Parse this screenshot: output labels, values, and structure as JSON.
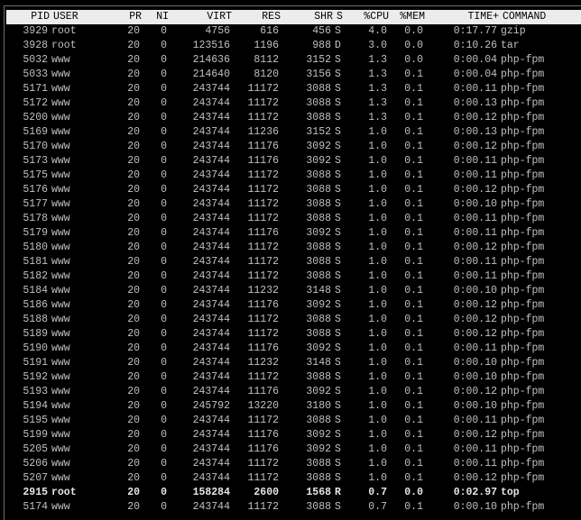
{
  "header": {
    "pid": "PID",
    "user": "USER",
    "pr": "PR",
    "ni": "NI",
    "virt": "VIRT",
    "res": "RES",
    "shr": "SHR",
    "s": "S",
    "cpu": "%CPU",
    "mem": "%MEM",
    "time": "TIME+",
    "command": "COMMAND"
  },
  "processes": [
    {
      "pid": "3929",
      "user": "root",
      "pr": "20",
      "ni": "0",
      "virt": "4756",
      "res": "616",
      "shr": "456",
      "s": "S",
      "cpu": "4.0",
      "mem": "0.0",
      "time": "0:17.77",
      "command": "gzip",
      "bold": false
    },
    {
      "pid": "3928",
      "user": "root",
      "pr": "20",
      "ni": "0",
      "virt": "123516",
      "res": "1196",
      "shr": "988",
      "s": "D",
      "cpu": "3.0",
      "mem": "0.0",
      "time": "0:10.26",
      "command": "tar",
      "bold": false
    },
    {
      "pid": "5032",
      "user": "www",
      "pr": "20",
      "ni": "0",
      "virt": "214636",
      "res": "8112",
      "shr": "3152",
      "s": "S",
      "cpu": "1.3",
      "mem": "0.0",
      "time": "0:00.04",
      "command": "php-fpm",
      "bold": false
    },
    {
      "pid": "5033",
      "user": "www",
      "pr": "20",
      "ni": "0",
      "virt": "214640",
      "res": "8120",
      "shr": "3156",
      "s": "S",
      "cpu": "1.3",
      "mem": "0.1",
      "time": "0:00.04",
      "command": "php-fpm",
      "bold": false
    },
    {
      "pid": "5171",
      "user": "www",
      "pr": "20",
      "ni": "0",
      "virt": "243744",
      "res": "11172",
      "shr": "3088",
      "s": "S",
      "cpu": "1.3",
      "mem": "0.1",
      "time": "0:00.11",
      "command": "php-fpm",
      "bold": false
    },
    {
      "pid": "5172",
      "user": "www",
      "pr": "20",
      "ni": "0",
      "virt": "243744",
      "res": "11172",
      "shr": "3088",
      "s": "S",
      "cpu": "1.3",
      "mem": "0.1",
      "time": "0:00.13",
      "command": "php-fpm",
      "bold": false
    },
    {
      "pid": "5200",
      "user": "www",
      "pr": "20",
      "ni": "0",
      "virt": "243744",
      "res": "11172",
      "shr": "3088",
      "s": "S",
      "cpu": "1.3",
      "mem": "0.1",
      "time": "0:00.12",
      "command": "php-fpm",
      "bold": false
    },
    {
      "pid": "5169",
      "user": "www",
      "pr": "20",
      "ni": "0",
      "virt": "243744",
      "res": "11236",
      "shr": "3152",
      "s": "S",
      "cpu": "1.0",
      "mem": "0.1",
      "time": "0:00.13",
      "command": "php-fpm",
      "bold": false
    },
    {
      "pid": "5170",
      "user": "www",
      "pr": "20",
      "ni": "0",
      "virt": "243744",
      "res": "11176",
      "shr": "3092",
      "s": "S",
      "cpu": "1.0",
      "mem": "0.1",
      "time": "0:00.12",
      "command": "php-fpm",
      "bold": false
    },
    {
      "pid": "5173",
      "user": "www",
      "pr": "20",
      "ni": "0",
      "virt": "243744",
      "res": "11176",
      "shr": "3092",
      "s": "S",
      "cpu": "1.0",
      "mem": "0.1",
      "time": "0:00.11",
      "command": "php-fpm",
      "bold": false
    },
    {
      "pid": "5175",
      "user": "www",
      "pr": "20",
      "ni": "0",
      "virt": "243744",
      "res": "11172",
      "shr": "3088",
      "s": "S",
      "cpu": "1.0",
      "mem": "0.1",
      "time": "0:00.11",
      "command": "php-fpm",
      "bold": false
    },
    {
      "pid": "5176",
      "user": "www",
      "pr": "20",
      "ni": "0",
      "virt": "243744",
      "res": "11172",
      "shr": "3088",
      "s": "S",
      "cpu": "1.0",
      "mem": "0.1",
      "time": "0:00.12",
      "command": "php-fpm",
      "bold": false
    },
    {
      "pid": "5177",
      "user": "www",
      "pr": "20",
      "ni": "0",
      "virt": "243744",
      "res": "11172",
      "shr": "3088",
      "s": "S",
      "cpu": "1.0",
      "mem": "0.1",
      "time": "0:00.10",
      "command": "php-fpm",
      "bold": false
    },
    {
      "pid": "5178",
      "user": "www",
      "pr": "20",
      "ni": "0",
      "virt": "243744",
      "res": "11172",
      "shr": "3088",
      "s": "S",
      "cpu": "1.0",
      "mem": "0.1",
      "time": "0:00.11",
      "command": "php-fpm",
      "bold": false
    },
    {
      "pid": "5179",
      "user": "www",
      "pr": "20",
      "ni": "0",
      "virt": "243744",
      "res": "11176",
      "shr": "3092",
      "s": "S",
      "cpu": "1.0",
      "mem": "0.1",
      "time": "0:00.11",
      "command": "php-fpm",
      "bold": false
    },
    {
      "pid": "5180",
      "user": "www",
      "pr": "20",
      "ni": "0",
      "virt": "243744",
      "res": "11172",
      "shr": "3088",
      "s": "S",
      "cpu": "1.0",
      "mem": "0.1",
      "time": "0:00.12",
      "command": "php-fpm",
      "bold": false
    },
    {
      "pid": "5181",
      "user": "www",
      "pr": "20",
      "ni": "0",
      "virt": "243744",
      "res": "11172",
      "shr": "3088",
      "s": "S",
      "cpu": "1.0",
      "mem": "0.1",
      "time": "0:00.11",
      "command": "php-fpm",
      "bold": false
    },
    {
      "pid": "5182",
      "user": "www",
      "pr": "20",
      "ni": "0",
      "virt": "243744",
      "res": "11172",
      "shr": "3088",
      "s": "S",
      "cpu": "1.0",
      "mem": "0.1",
      "time": "0:00.11",
      "command": "php-fpm",
      "bold": false
    },
    {
      "pid": "5184",
      "user": "www",
      "pr": "20",
      "ni": "0",
      "virt": "243744",
      "res": "11232",
      "shr": "3148",
      "s": "S",
      "cpu": "1.0",
      "mem": "0.1",
      "time": "0:00.10",
      "command": "php-fpm",
      "bold": false
    },
    {
      "pid": "5186",
      "user": "www",
      "pr": "20",
      "ni": "0",
      "virt": "243744",
      "res": "11176",
      "shr": "3092",
      "s": "S",
      "cpu": "1.0",
      "mem": "0.1",
      "time": "0:00.12",
      "command": "php-fpm",
      "bold": false
    },
    {
      "pid": "5188",
      "user": "www",
      "pr": "20",
      "ni": "0",
      "virt": "243744",
      "res": "11172",
      "shr": "3088",
      "s": "S",
      "cpu": "1.0",
      "mem": "0.1",
      "time": "0:00.12",
      "command": "php-fpm",
      "bold": false
    },
    {
      "pid": "5189",
      "user": "www",
      "pr": "20",
      "ni": "0",
      "virt": "243744",
      "res": "11172",
      "shr": "3088",
      "s": "S",
      "cpu": "1.0",
      "mem": "0.1",
      "time": "0:00.12",
      "command": "php-fpm",
      "bold": false
    },
    {
      "pid": "5190",
      "user": "www",
      "pr": "20",
      "ni": "0",
      "virt": "243744",
      "res": "11176",
      "shr": "3092",
      "s": "S",
      "cpu": "1.0",
      "mem": "0.1",
      "time": "0:00.11",
      "command": "php-fpm",
      "bold": false
    },
    {
      "pid": "5191",
      "user": "www",
      "pr": "20",
      "ni": "0",
      "virt": "243744",
      "res": "11232",
      "shr": "3148",
      "s": "S",
      "cpu": "1.0",
      "mem": "0.1",
      "time": "0:00.10",
      "command": "php-fpm",
      "bold": false
    },
    {
      "pid": "5192",
      "user": "www",
      "pr": "20",
      "ni": "0",
      "virt": "243744",
      "res": "11172",
      "shr": "3088",
      "s": "S",
      "cpu": "1.0",
      "mem": "0.1",
      "time": "0:00.10",
      "command": "php-fpm",
      "bold": false
    },
    {
      "pid": "5193",
      "user": "www",
      "pr": "20",
      "ni": "0",
      "virt": "243744",
      "res": "11176",
      "shr": "3092",
      "s": "S",
      "cpu": "1.0",
      "mem": "0.1",
      "time": "0:00.12",
      "command": "php-fpm",
      "bold": false
    },
    {
      "pid": "5194",
      "user": "www",
      "pr": "20",
      "ni": "0",
      "virt": "245792",
      "res": "13220",
      "shr": "3180",
      "s": "S",
      "cpu": "1.0",
      "mem": "0.1",
      "time": "0:00.10",
      "command": "php-fpm",
      "bold": false
    },
    {
      "pid": "5195",
      "user": "www",
      "pr": "20",
      "ni": "0",
      "virt": "243744",
      "res": "11172",
      "shr": "3088",
      "s": "S",
      "cpu": "1.0",
      "mem": "0.1",
      "time": "0:00.11",
      "command": "php-fpm",
      "bold": false
    },
    {
      "pid": "5199",
      "user": "www",
      "pr": "20",
      "ni": "0",
      "virt": "243744",
      "res": "11176",
      "shr": "3092",
      "s": "S",
      "cpu": "1.0",
      "mem": "0.1",
      "time": "0:00.12",
      "command": "php-fpm",
      "bold": false
    },
    {
      "pid": "5205",
      "user": "www",
      "pr": "20",
      "ni": "0",
      "virt": "243744",
      "res": "11176",
      "shr": "3092",
      "s": "S",
      "cpu": "1.0",
      "mem": "0.1",
      "time": "0:00.11",
      "command": "php-fpm",
      "bold": false
    },
    {
      "pid": "5206",
      "user": "www",
      "pr": "20",
      "ni": "0",
      "virt": "243744",
      "res": "11172",
      "shr": "3088",
      "s": "S",
      "cpu": "1.0",
      "mem": "0.1",
      "time": "0:00.11",
      "command": "php-fpm",
      "bold": false
    },
    {
      "pid": "5207",
      "user": "www",
      "pr": "20",
      "ni": "0",
      "virt": "243744",
      "res": "11172",
      "shr": "3088",
      "s": "S",
      "cpu": "1.0",
      "mem": "0.1",
      "time": "0:00.12",
      "command": "php-fpm",
      "bold": false
    },
    {
      "pid": "2915",
      "user": "root",
      "pr": "20",
      "ni": "0",
      "virt": "158284",
      "res": "2600",
      "shr": "1568",
      "s": "R",
      "cpu": "0.7",
      "mem": "0.0",
      "time": "0:02.97",
      "command": "top",
      "bold": true
    },
    {
      "pid": "5174",
      "user": "www",
      "pr": "20",
      "ni": "0",
      "virt": "243744",
      "res": "11172",
      "shr": "3088",
      "s": "S",
      "cpu": "0.7",
      "mem": "0.1",
      "time": "0:00.10",
      "command": "php-fpm",
      "bold": false
    }
  ]
}
